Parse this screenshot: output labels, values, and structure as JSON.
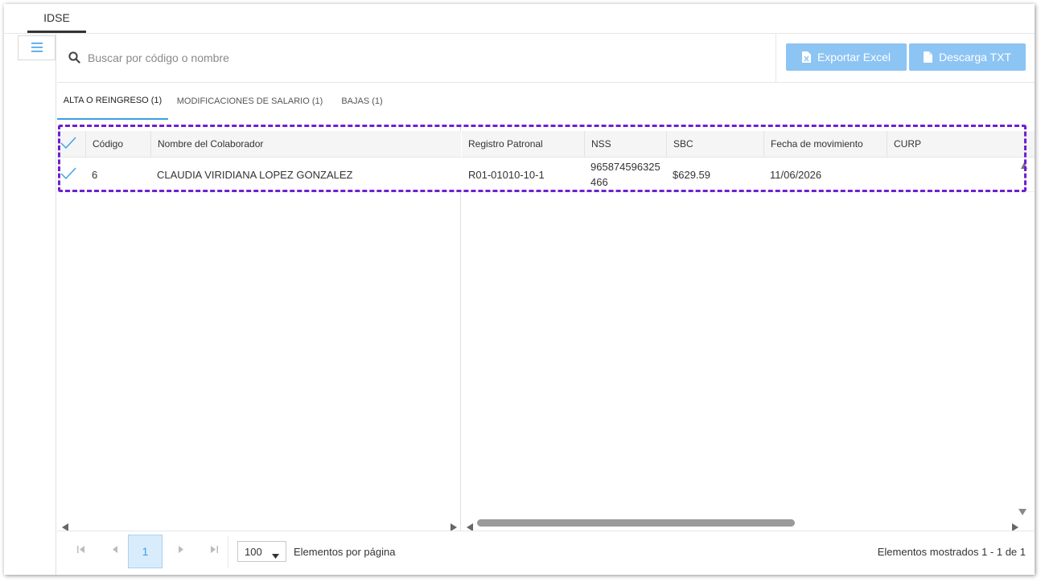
{
  "window": {
    "tab": "IDSE"
  },
  "toolbar": {
    "search_placeholder": "Buscar por código o nombre",
    "export_excel_label": "Exportar Excel",
    "download_txt_label": "Descarga TXT",
    "accent": "#8cc4f4"
  },
  "subtabs": [
    {
      "label": "ALTA O REINGRESO (1)",
      "active": true
    },
    {
      "label": "MODIFICACIONES DE SALARIO (1)",
      "active": false
    },
    {
      "label": "BAJAS (1)",
      "active": false
    }
  ],
  "table": {
    "columns": [
      "Código",
      "Nombre del Colaborador",
      "Registro Patronal",
      "NSS",
      "SBC",
      "Fecha de movimiento",
      "CURP"
    ],
    "rows": [
      {
        "codigo": "6",
        "nombre": "CLAUDIA VIRIDIANA LOPEZ GONZALEZ",
        "registro_patronal": "R01-01010-10-1",
        "nss_line1": "965874596325",
        "nss_line2": "466",
        "sbc": "$629.59",
        "fecha": "11/06/2026",
        "curp": ""
      }
    ]
  },
  "pager": {
    "current_page": "1",
    "page_size": "100",
    "page_size_label": "Elementos por página",
    "info": "Elementos mostrados 1 - 1 de 1"
  },
  "colors": {
    "selection_outline": "#6f1fd1",
    "check": "#3c9ee5",
    "active_tab_underline": "#3c9ee5"
  }
}
